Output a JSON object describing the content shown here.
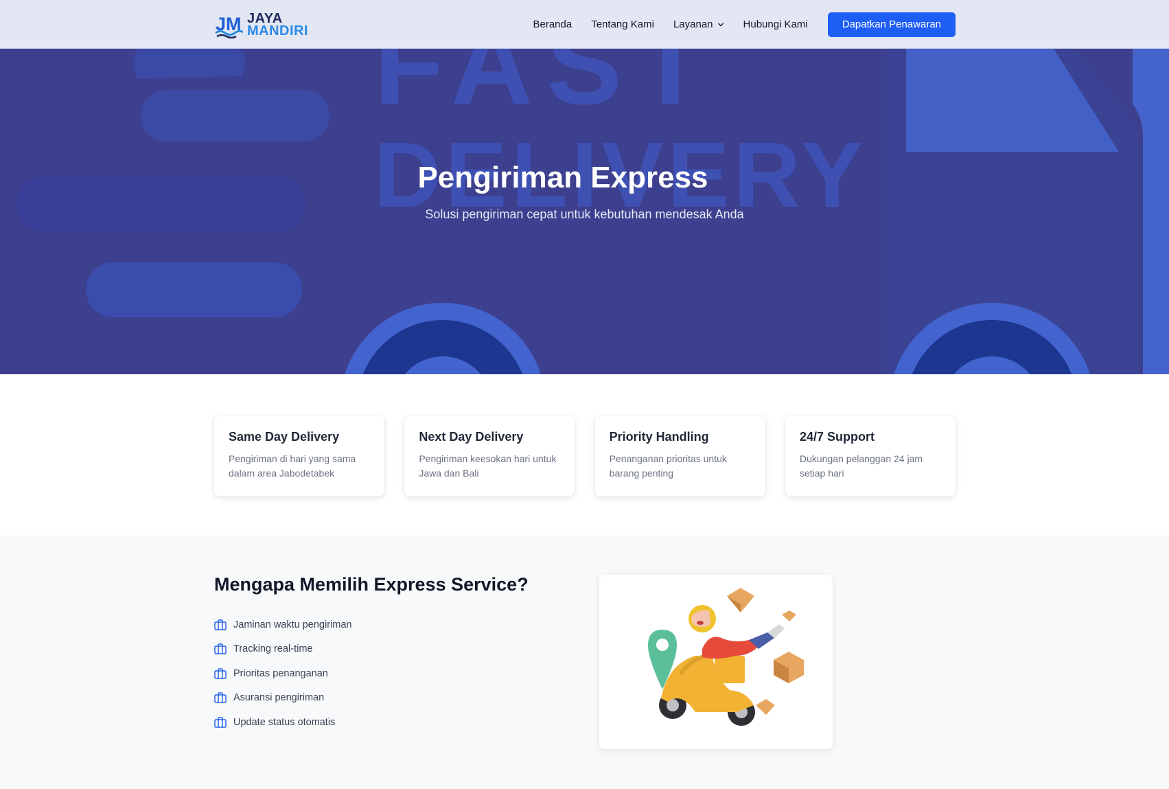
{
  "header": {
    "logo": {
      "monogram": "JM",
      "line1": "JAYA",
      "line2": "MANDIRI"
    },
    "nav": [
      {
        "label": "Beranda"
      },
      {
        "label": "Tentang Kami"
      },
      {
        "label": "Layanan",
        "has_dropdown": true
      },
      {
        "label": "Hubungi Kami"
      }
    ],
    "cta_label": "Dapatkan Penawaran"
  },
  "hero": {
    "background_text_1": "FAST",
    "background_text_2": "DELIVERY",
    "title": "Pengiriman Express",
    "subtitle": "Solusi pengiriman cepat untuk kebutuhan mendesak Anda"
  },
  "features": [
    {
      "title": "Same Day Delivery",
      "description": "Pengiriman di hari yang sama dalam area Jabodetabek"
    },
    {
      "title": "Next Day Delivery",
      "description": "Pengiriman keesokan hari untuk Jawa dan Bali"
    },
    {
      "title": "Priority Handling",
      "description": "Penanganan prioritas untuk barang penting"
    },
    {
      "title": "24/7 Support",
      "description": "Dukungan pelanggan 24 jam setiap hari"
    }
  ],
  "why": {
    "title": "Mengapa Memilih Express Service?",
    "items": [
      "Jaminan waktu pengiriman",
      "Tracking real-time",
      "Prioritas penanganan",
      "Asuransi pengiriman",
      "Update status otomatis"
    ],
    "icon": "briefcase-icon"
  },
  "colors": {
    "primary": "#1f5ef5",
    "hero_bg": "#3d3f8f",
    "hero_shape": "#4160c4",
    "logo_blue": "#2b8ae6",
    "logo_dark": "#1e2a5c"
  }
}
